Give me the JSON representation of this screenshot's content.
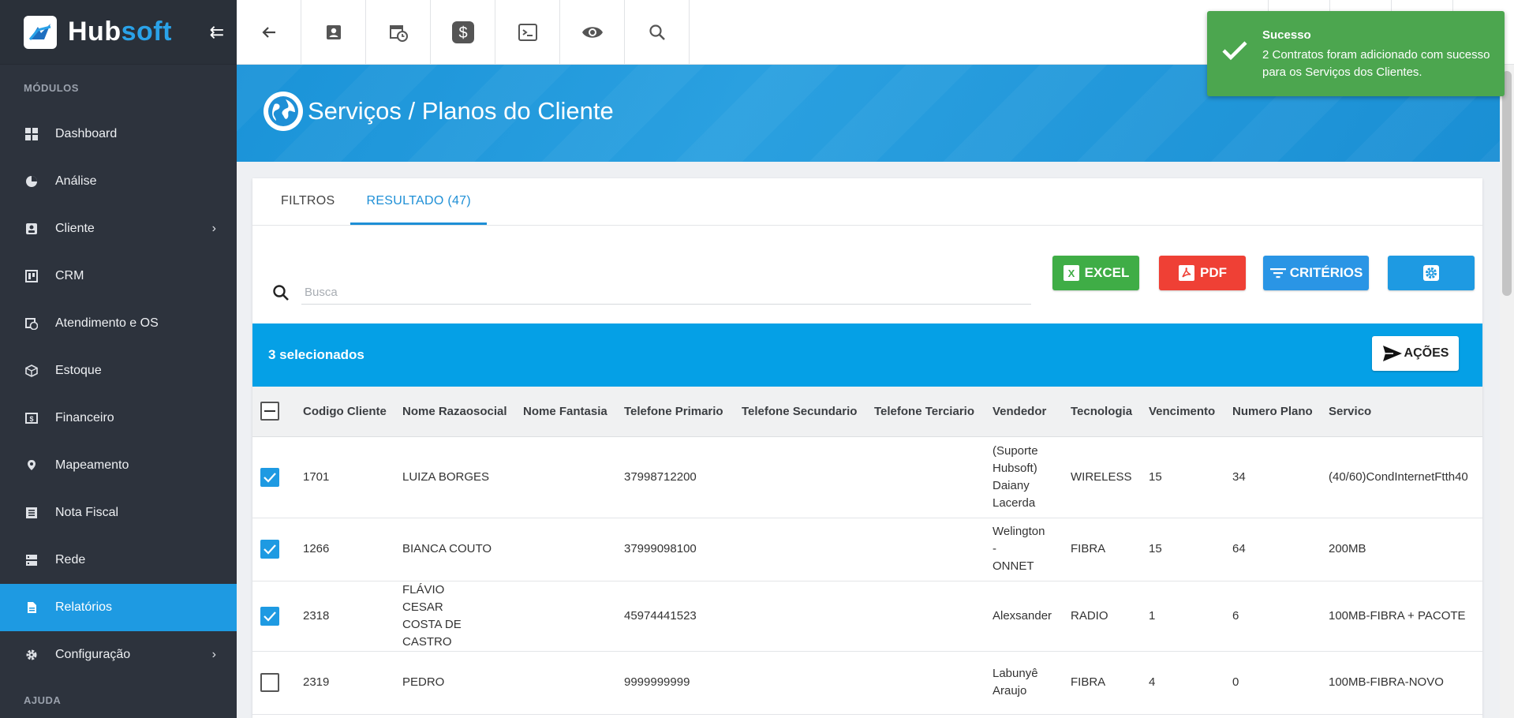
{
  "brand": {
    "name_main": "Hub",
    "name_accent": "soft"
  },
  "sidebar": {
    "section_modules": "MÓDULOS",
    "section_help": "AJUDA",
    "items": [
      {
        "label": "Dashboard",
        "icon": "dashboard-icon"
      },
      {
        "label": "Análise",
        "icon": "pie-chart-icon"
      },
      {
        "label": "Cliente",
        "icon": "contact-card-icon"
      },
      {
        "label": "CRM",
        "icon": "trello-board-icon"
      },
      {
        "label": "Atendimento e OS",
        "icon": "calendar-clock-icon"
      },
      {
        "label": "Estoque",
        "icon": "box-icon"
      },
      {
        "label": "Financeiro",
        "icon": "money-icon"
      },
      {
        "label": "Mapeamento",
        "icon": "map-pin-icon"
      },
      {
        "label": "Nota Fiscal",
        "icon": "receipt-icon"
      },
      {
        "label": "Rede",
        "icon": "server-icon"
      },
      {
        "label": "Relatórios",
        "icon": "document-icon"
      },
      {
        "label": "Configuração",
        "icon": "gear-icon"
      }
    ]
  },
  "header": {
    "title": "Serviços / Planos do Cliente"
  },
  "tabs": {
    "filtros": "FILTROS",
    "resultado": "RESULTADO (47)"
  },
  "search": {
    "placeholder": "Busca",
    "value": ""
  },
  "buttons": {
    "excel": "EXCEL",
    "pdf": "PDF",
    "criterios": "CRITÉRIOS",
    "acoes": "AÇÕES"
  },
  "selection": {
    "text": "3 selecionados"
  },
  "table": {
    "columns": [
      "Codigo Cliente",
      "Nome Razaosocial",
      "Nome Fantasia",
      "Telefone Primario",
      "Telefone Secundario",
      "Telefone Terciario",
      "Vendedor",
      "Tecnologia",
      "Vencimento",
      "Numero Plano",
      "Servico"
    ],
    "rows": [
      {
        "checked": true,
        "codigo": "1701",
        "nome": "LUIZA BORGES",
        "fantasia": "",
        "tel1": "37998712200",
        "tel2": "",
        "tel3": "",
        "vendedor": "(Suporte Hubsoft) Daiany Lacerda",
        "tecnologia": "WIRELESS",
        "vencimento": "15",
        "plano": "34",
        "servico": "(40/60)CondInternetFtth40"
      },
      {
        "checked": true,
        "codigo": "1266",
        "nome": "BIANCA COUTO",
        "fantasia": "",
        "tel1": "37999098100",
        "tel2": "",
        "tel3": "",
        "vendedor": "Welington - ONNET",
        "tecnologia": "FIBRA",
        "vencimento": "15",
        "plano": "64",
        "servico": "200MB"
      },
      {
        "checked": true,
        "codigo": "2318",
        "nome": "FLÁVIO CESAR COSTA DE CASTRO",
        "fantasia": "",
        "tel1": "45974441523",
        "tel2": "",
        "tel3": "",
        "vendedor": "Alexsander",
        "tecnologia": "RADIO",
        "vencimento": "1",
        "plano": "6",
        "servico": "100MB-FIBRA + PACOTE"
      },
      {
        "checked": false,
        "codigo": "2319",
        "nome": "PEDRO",
        "fantasia": "",
        "tel1": "9999999999",
        "tel2": "",
        "tel3": "",
        "vendedor": "Labunyê Araujo",
        "tecnologia": "FIBRA",
        "vencimento": "4",
        "plano": "0",
        "servico": "100MB-FIBRA-NOVO"
      }
    ]
  },
  "toast": {
    "title": "Sucesso",
    "message": "2 Contratos foram adicionado com sucesso para os Serviços dos Clientes."
  },
  "colors": {
    "primary": "#1e9ae2",
    "sidebar": "#2d333d",
    "success": "#4ca64f",
    "excel": "#3fad46",
    "pdf": "#ef4035"
  }
}
